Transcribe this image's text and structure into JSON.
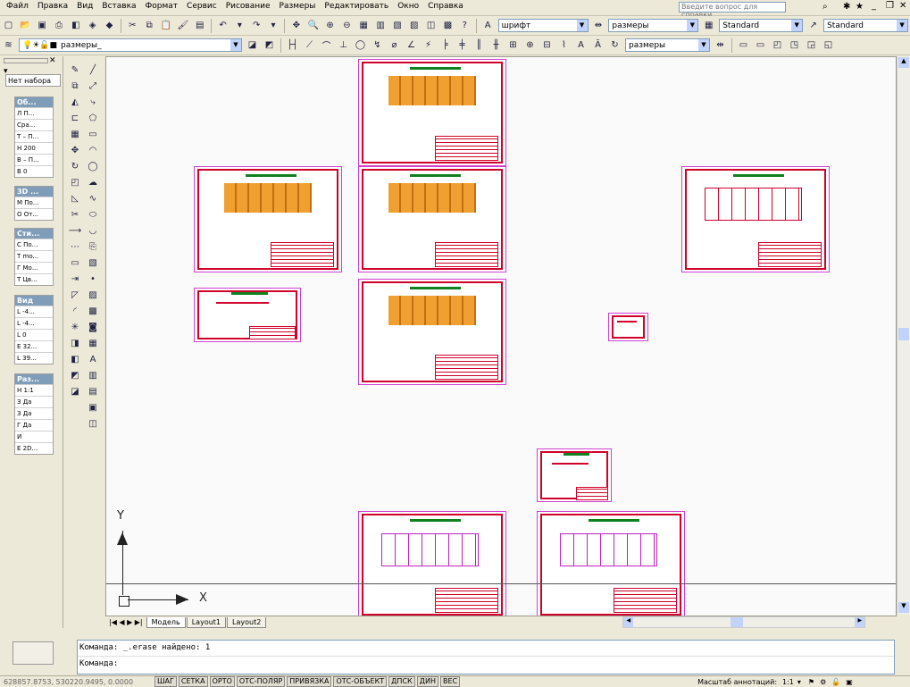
{
  "menu": [
    "Файл",
    "Правка",
    "Вид",
    "Вставка",
    "Формат",
    "Сервис",
    "Рисование",
    "Размеры",
    "Редактировать",
    "Окно",
    "Справка"
  ],
  "help_search_placeholder": "Введите вопрос для справки",
  "toolbar1": {
    "text_style_combo": "шрифт",
    "dim_style_combo": "размеры",
    "table_style_combo": "Standard",
    "multileader_style_combo": "Standard"
  },
  "toolbar2": {
    "layer_combo": "размеры_",
    "dim_style_combo2": "размеры"
  },
  "palette": {
    "no_selection": "Нет набора",
    "groups": [
      {
        "title": "Об...",
        "rows": [
          "Л  П...",
          "Сра...",
          "Т – П...",
          "Н 200",
          "В – П...",
          "В 0"
        ]
      },
      {
        "title": "3D ...",
        "rows": [
          "М По...",
          "О От..."
        ]
      },
      {
        "title": "Сти...",
        "rows": [
          "С По...",
          "Т mo...",
          "Г Мо...",
          "Т Цв..."
        ]
      },
      {
        "title": "Вид",
        "rows": [
          "L -4...",
          "L -4...",
          "L 0",
          "Е 32...",
          "L 39..."
        ]
      },
      {
        "title": "Раз...",
        "rows": [
          "Н 1:1",
          "З Да",
          "З Да",
          "Г Да",
          "И",
          "Е 2D..."
        ]
      }
    ]
  },
  "axis": {
    "y": "Y",
    "x": "X"
  },
  "tabs": [
    "Модель",
    "Layout1",
    "Layout2"
  ],
  "command": {
    "line1": "Команда:  _.erase найдено: 1",
    "line2": "Команда:"
  },
  "status": {
    "coords": "628857.8753, 530220.9495, 0.0000",
    "buttons": [
      "ШАГ",
      "СЕТКА",
      "ОРТО",
      "ОТС-ПОЛЯР",
      "ПРИВЯЗКА",
      "ОТС-ОБЪЕКТ",
      "ДПСК",
      "ДИН",
      "ВЕС"
    ],
    "annot_scale_label": "Масштаб аннотаций:",
    "annot_scale": "1:1"
  },
  "colors": {
    "frame": "#d0002a",
    "sheet_border": "#d040d0",
    "orange": "#f0a030",
    "green": "#108020"
  }
}
